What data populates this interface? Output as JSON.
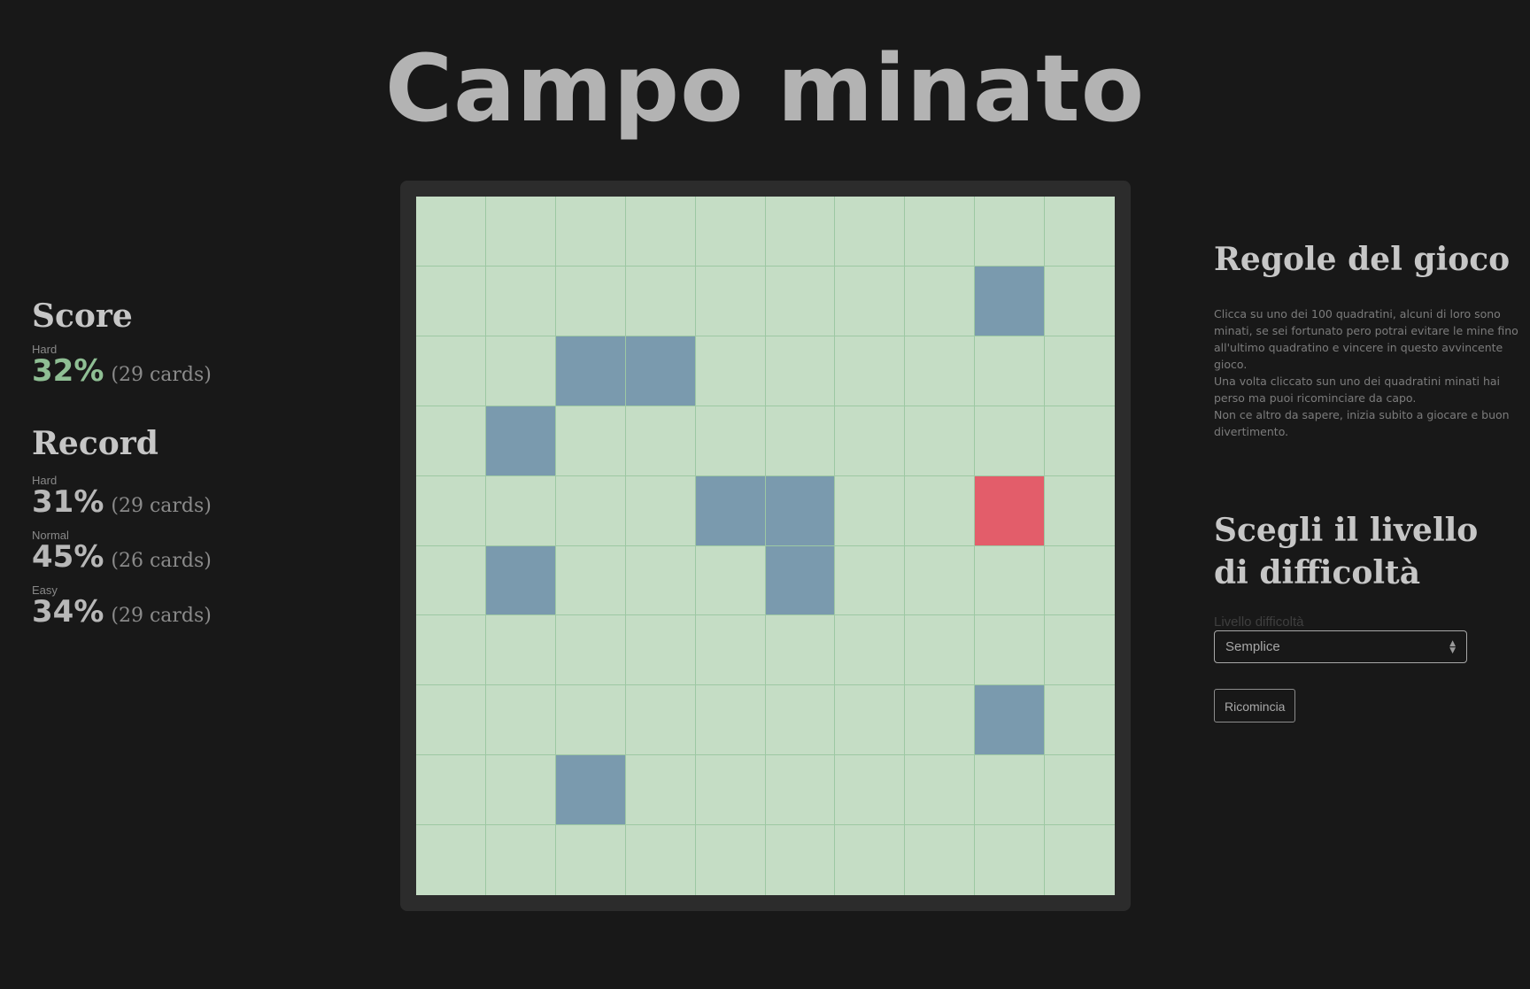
{
  "header": {
    "title": "Campo minato"
  },
  "score": {
    "title": "Score",
    "current": {
      "level": "Hard",
      "percent": "32%",
      "cards": "(29 cards)"
    }
  },
  "record": {
    "title": "Record",
    "entries": [
      {
        "level": "Hard",
        "percent": "31%",
        "cards": "(29 cards)"
      },
      {
        "level": "Normal",
        "percent": "45%",
        "cards": "(26 cards)"
      },
      {
        "level": "Easy",
        "percent": "34%",
        "cards": "(29 cards)"
      }
    ]
  },
  "board": {
    "rows": 10,
    "cols": 10,
    "revealed": [
      [
        1,
        8
      ],
      [
        2,
        2
      ],
      [
        2,
        3
      ],
      [
        3,
        1
      ],
      [
        4,
        4
      ],
      [
        4,
        5
      ],
      [
        5,
        1
      ],
      [
        5,
        5
      ],
      [
        7,
        8
      ],
      [
        8,
        2
      ]
    ],
    "mine": [
      4,
      8
    ],
    "colors": {
      "hidden": "#c5ddc5",
      "revealed": "#7a9aae",
      "mine": "#e35d6a",
      "frame": "#2c2c2c"
    }
  },
  "rules": {
    "title": "Regole del gioco",
    "lines": [
      "Clicca su uno dei 100 quadratini, alcuni di loro sono minati, se sei fortunato pero potrai evitare le mine fino all'ultimo quadratino e vincere in questo avvincente gioco.",
      "Una volta cliccato sun uno dei quadratini minati hai perso ma puoi ricominciare da capo.",
      "Non ce altro da sapere, inizia subito a giocare e buon divertimento."
    ]
  },
  "difficulty": {
    "title": "Scegli il livello di difficoltà",
    "label": "Livello difficoltà",
    "selected": "Semplice",
    "restart_label": "Ricomincia"
  }
}
